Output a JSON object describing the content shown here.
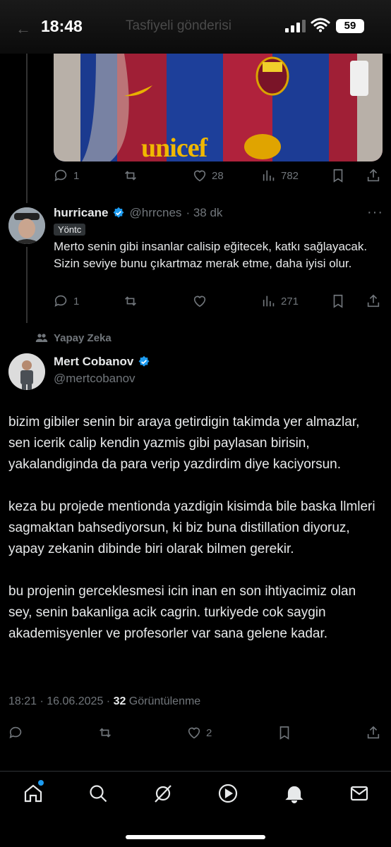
{
  "status_bar": {
    "time": "18:48",
    "faded_title": "Tasfiyeli gönderisi",
    "battery": "59"
  },
  "media_post_actions": {
    "replies": "1",
    "reposts": "",
    "likes": "28",
    "views": "782"
  },
  "reply": {
    "name": "hurricane",
    "handle": "@hrrcnes",
    "time": "· 38 dk",
    "label_badge": "Yöntc",
    "text": "Merto senin gibi insanlar calisip eğitecek, katkı sağlayacak. Sizin seviye bunu çıkartmaz merak etme, daha iyisi olur.",
    "actions": {
      "replies": "1",
      "views": "271"
    }
  },
  "context_label": "Yapay Zeka",
  "main_post": {
    "name": "Mert Cobanov",
    "handle": "@mertcobanov",
    "paragraphs": [
      "bizim gibiler senin bir araya getirdigin takimda yer almazlar, sen icerik calip kendin yazmis gibi paylasan birisin, yakalandiginda da para verip yazdirdim diye kaciyorsun.",
      "keza bu projede mentionda yazdigin kisimda bile baska llmleri sagmaktan bahsediyorsun, ki biz buna distillation diyoruz, yapay zekanin dibinde biri olarak bilmen gerekir.",
      "bu projenin gerceklesmesi icin inan en son ihtiyacimiz olan sey, senin bakanliga acik cagrin. turkiyede cok saygin akademisyenler ve profesorler var sana gelene kadar."
    ],
    "timestamp": "18:21 · 16.06.2025 · ",
    "views_count": "32",
    "views_label": " Görüntülenme",
    "likes": "2"
  },
  "colors": {
    "accent": "#1d9bf0",
    "muted": "#71767b",
    "background": "#000000",
    "text": "#e7e9ea"
  },
  "nav": [
    "home-icon",
    "search-icon",
    "grok-icon",
    "video-icon",
    "bell-icon",
    "mail-icon"
  ]
}
